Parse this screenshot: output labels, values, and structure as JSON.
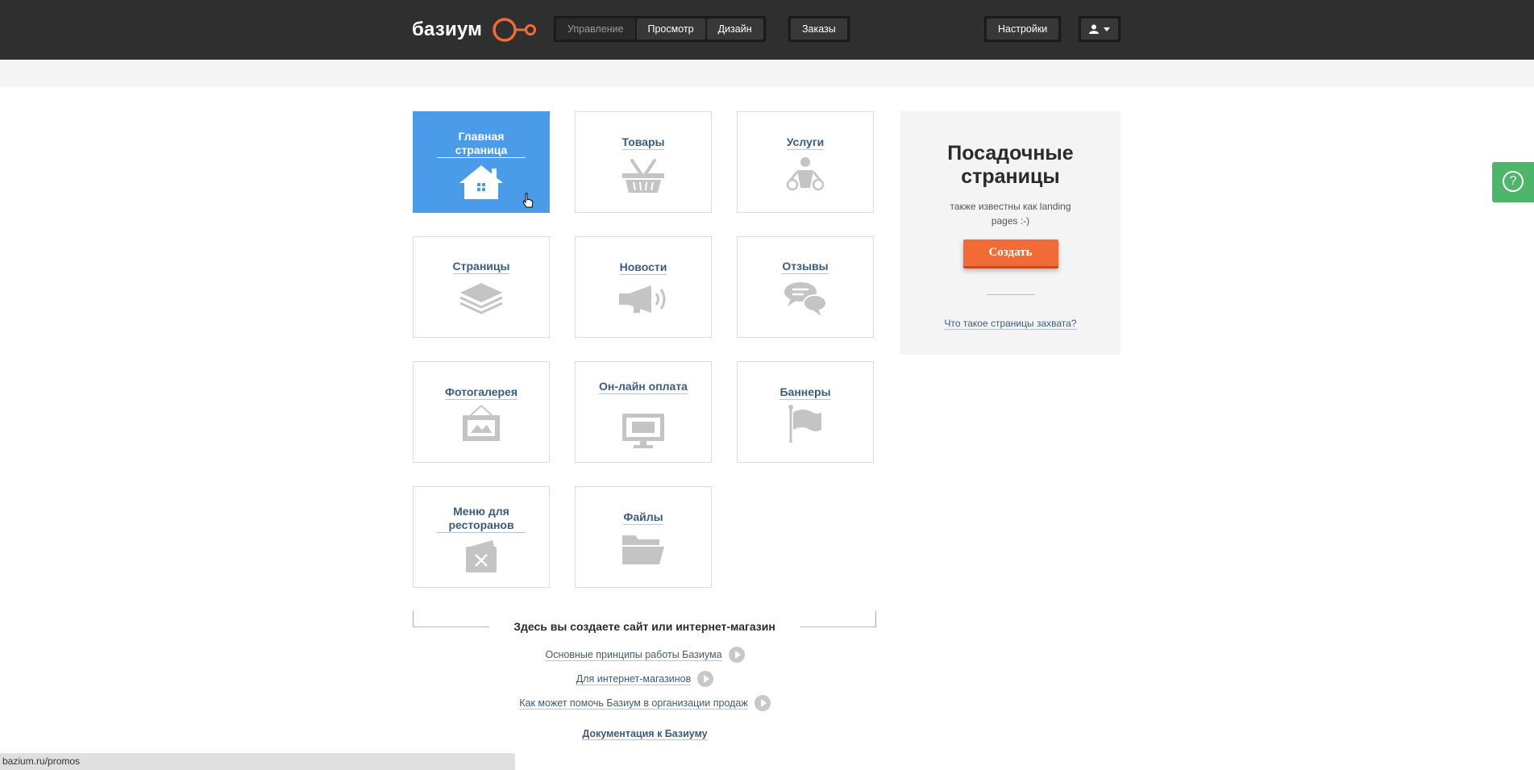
{
  "header": {
    "logo_text": "базиум",
    "nav": [
      "Управление",
      "Просмотр",
      "Дизайн"
    ],
    "orders_label": "Заказы",
    "settings_label": "Настройки"
  },
  "tiles": [
    {
      "label": "Главная страница",
      "icon": "home-icon"
    },
    {
      "label": "Товары",
      "icon": "basket-icon"
    },
    {
      "label": "Услуги",
      "icon": "services-icon"
    },
    {
      "label": "Страницы",
      "icon": "pages-stack-icon"
    },
    {
      "label": "Новости",
      "icon": "megaphone-icon"
    },
    {
      "label": "Отзывы",
      "icon": "chat-bubbles-icon"
    },
    {
      "label": "Фотогалерея",
      "icon": "picture-frame-icon"
    },
    {
      "label": "Он-лайн оплата",
      "icon": "payment-monitor-icon"
    },
    {
      "label": "Баннеры",
      "icon": "flag-icon"
    },
    {
      "label": "Меню для ресторанов",
      "icon": "restaurant-menu-icon"
    },
    {
      "label": "Файлы",
      "icon": "folder-icon"
    }
  ],
  "promo": {
    "title": "Посадочные страницы",
    "subtitle": "также известны как landing pages :-)",
    "create_label": "Создать",
    "link": "Что такое страницы захвата?"
  },
  "intro": {
    "title": "Здесь вы создаете сайт или интернет-магазин",
    "videos": [
      "Основные принципы работы Базиума",
      "Для интернет-магазинов",
      "Как может помочь Базиум в организации продаж"
    ],
    "docs": "Документация к Базиуму"
  },
  "help_label": "?",
  "status_url": "bazium.ru/promos",
  "colors": {
    "active_tile": "#4a9ce8",
    "accent": "#f26a35",
    "help": "#4db66b",
    "topbar": "#2f2f2f"
  }
}
